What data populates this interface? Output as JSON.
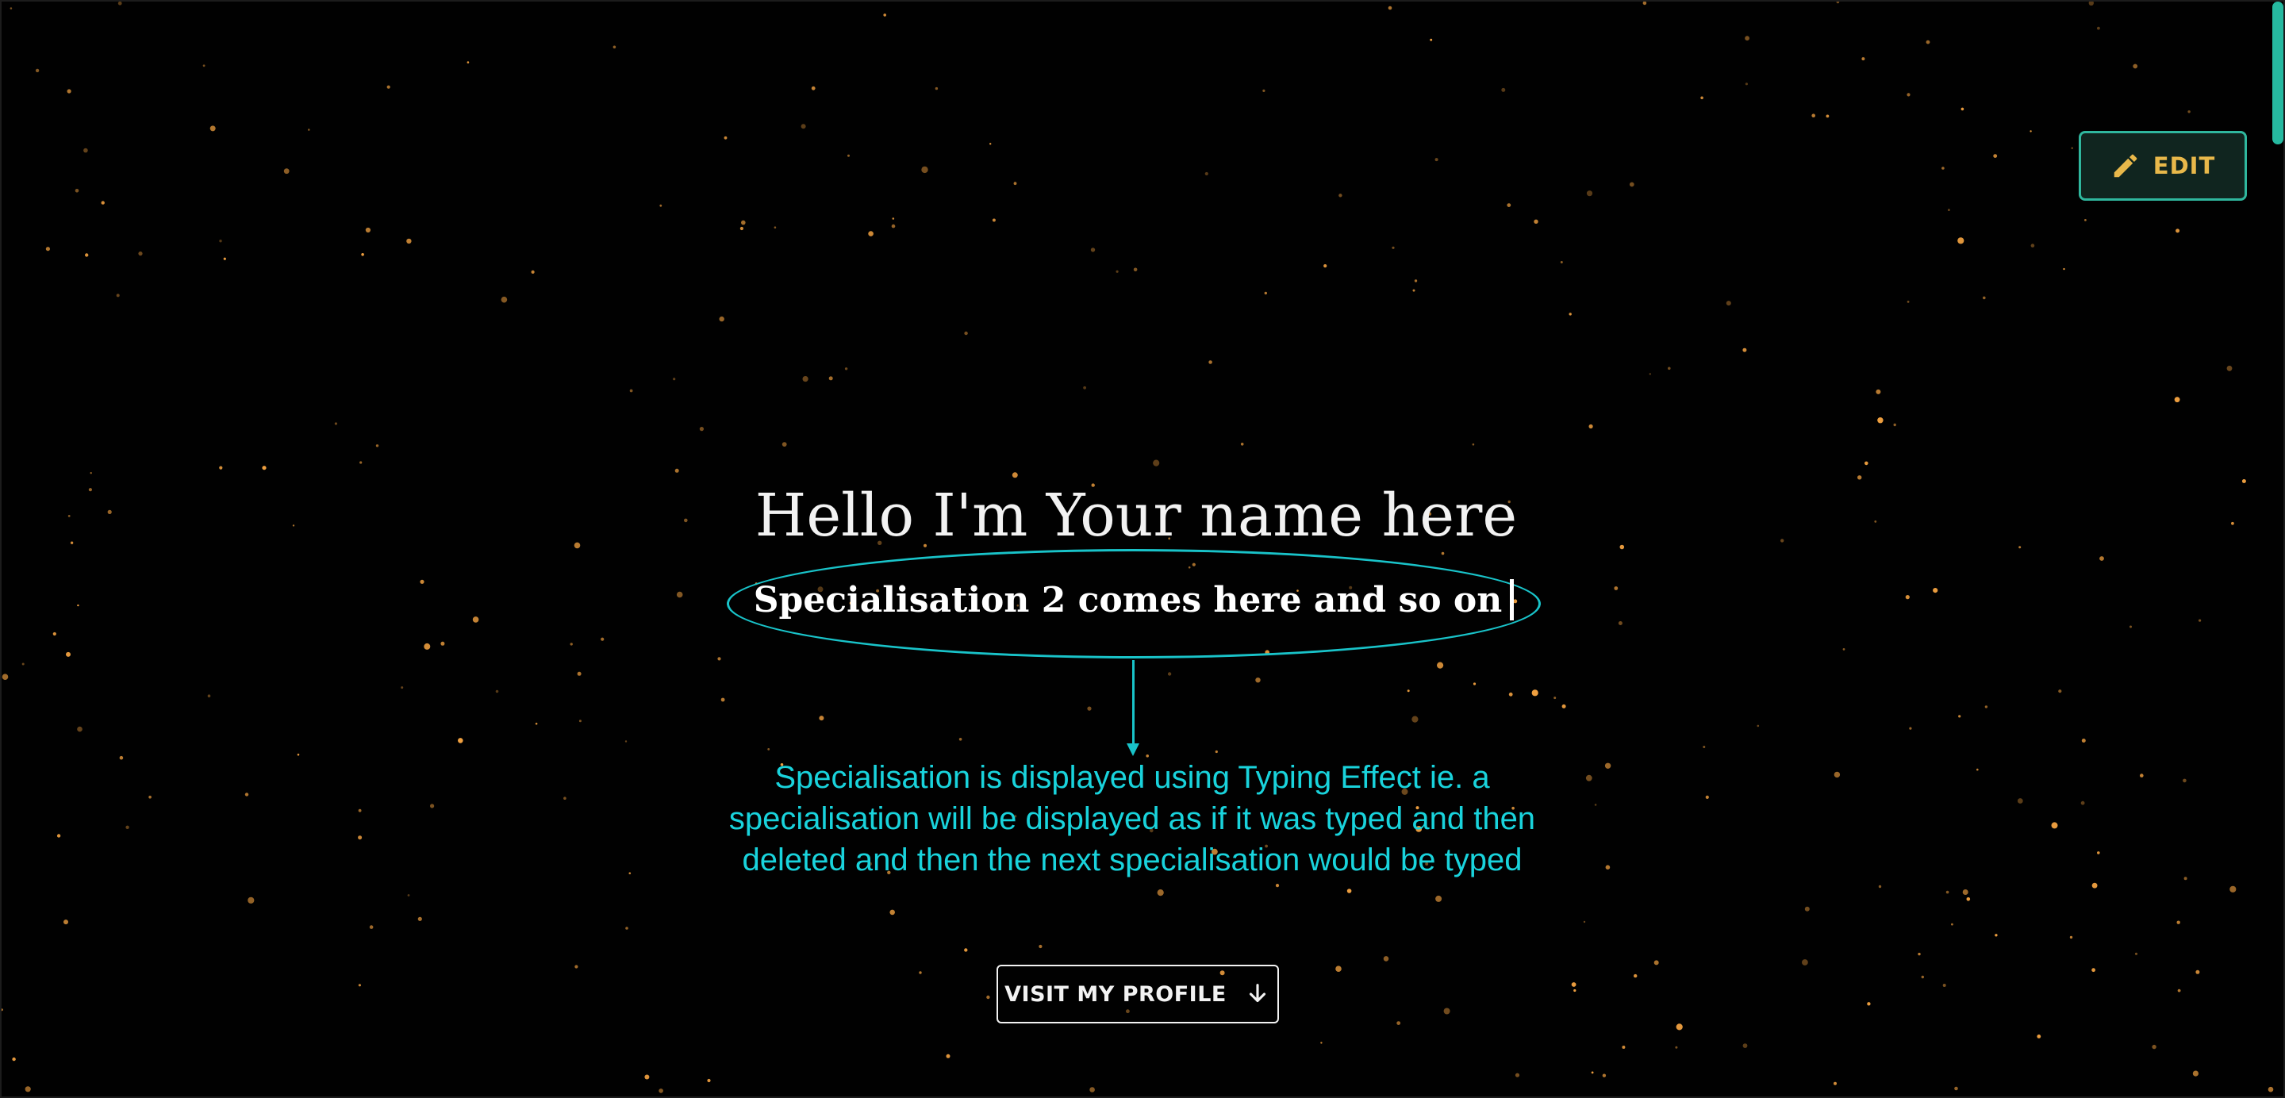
{
  "colors": {
    "background": "#010101",
    "star": "#f0a040",
    "accent_teal": "#2fb79e",
    "edit_text": "#e8b84a",
    "annotation_cyan": "#19d3dc"
  },
  "edit_button": {
    "label": "EDIT",
    "icon": "pencil-icon"
  },
  "hero": {
    "title": "Hello I'm Your name here",
    "specialisation": "Specialisation 2 comes here and so on"
  },
  "annotation": {
    "text": "Specialisation is displayed using Typing Effect ie. a specialisation will be displayed as if it was typed and then deleted and then the next specialisation would be typed"
  },
  "visit_button": {
    "label": "VISIT MY PROFILE",
    "icon": "arrow-down-icon"
  }
}
